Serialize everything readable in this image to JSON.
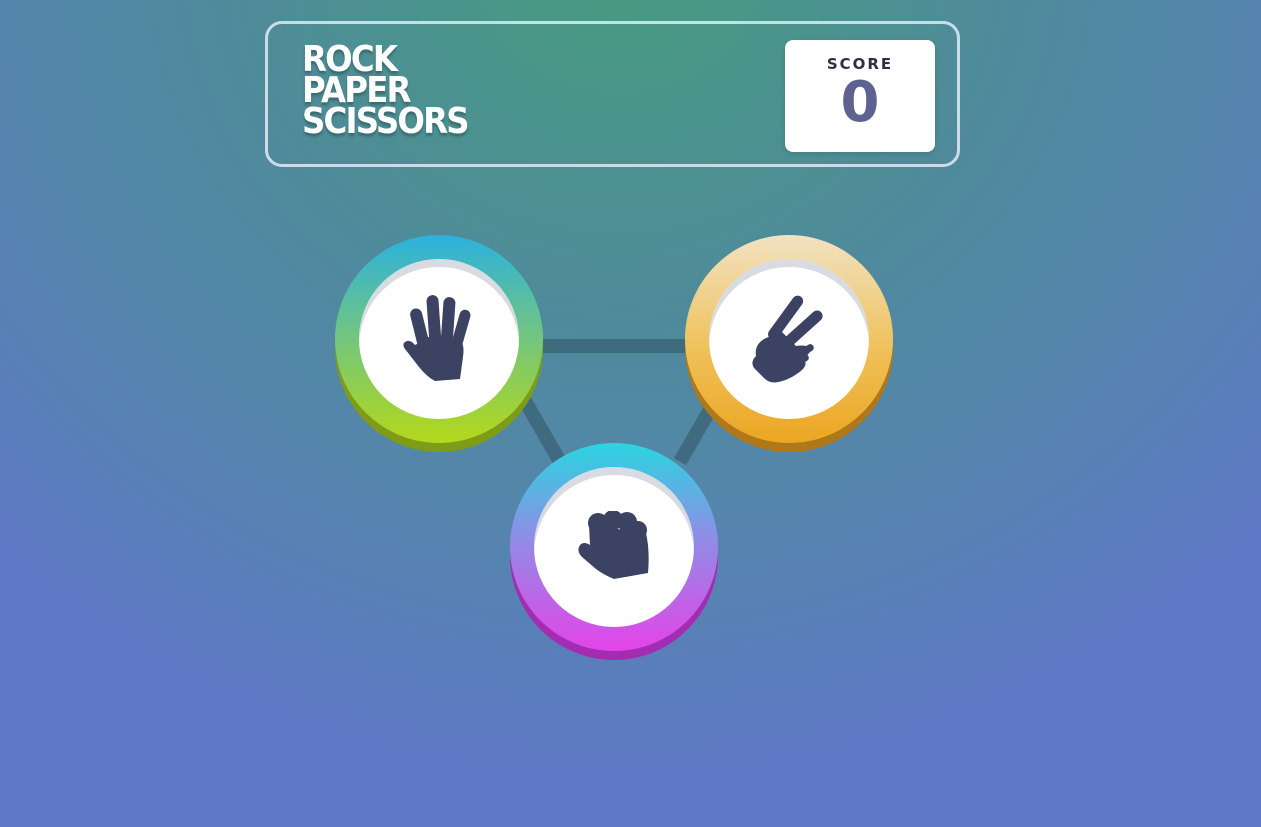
{
  "header": {
    "title_lines": [
      "ROCK",
      "PAPER",
      "SCISSORS"
    ],
    "score_label": "SCORE",
    "score_value": "0"
  },
  "choices": [
    {
      "name": "paper",
      "icon": "paper-hand-icon",
      "color": "#b4d81a"
    },
    {
      "name": "scissors",
      "icon": "scissors-hand-icon",
      "color": "#eca622"
    },
    {
      "name": "rock",
      "icon": "rock-fist-icon",
      "color": "#e444e8"
    }
  ],
  "colors": {
    "icon": "#3b4262",
    "score_value": "#5d6291"
  }
}
